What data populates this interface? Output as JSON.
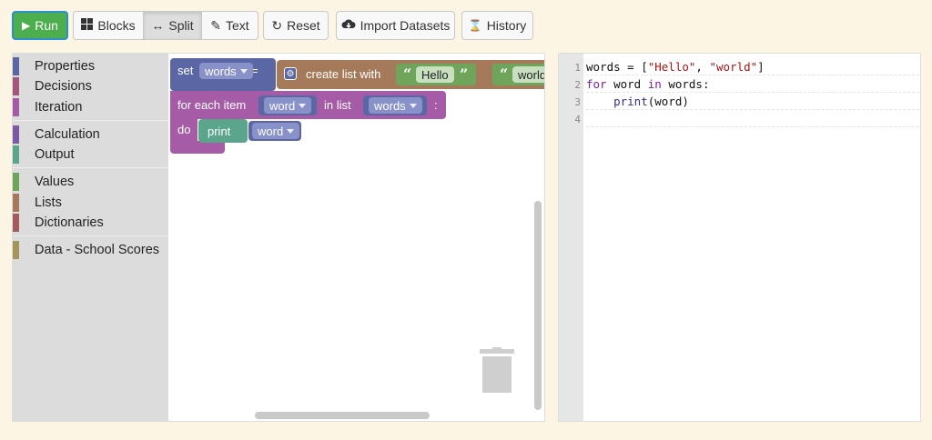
{
  "toolbar": {
    "run": "Run",
    "blocks": "Blocks",
    "split": "Split",
    "text": "Text",
    "reset": "Reset",
    "import": "Import Datasets",
    "history": "History"
  },
  "toolbox": {
    "categories": [
      {
        "label": "Properties",
        "color": "#5b67a5"
      },
      {
        "label": "Decisions",
        "color": "#a5577a"
      },
      {
        "label": "Iteration",
        "color": "#a55ba5"
      },
      {
        "label": "Calculation",
        "color": "#7b59a5"
      },
      {
        "label": "Output",
        "color": "#5ba58c"
      },
      {
        "label": "Values",
        "color": "#6fa55b"
      },
      {
        "label": "Lists",
        "color": "#a57a5b"
      },
      {
        "label": "Dictionaries",
        "color": "#a55b5b"
      },
      {
        "label": "Data - School Scores",
        "color": "#a5955b"
      }
    ]
  },
  "blocks": {
    "set_label": "set",
    "set_var": "words",
    "equals": "=",
    "create_list": "create list with",
    "item1": "Hello",
    "item2": "world",
    "for_each": "for each item",
    "for_var": "word",
    "in_list": "in list",
    "list_var": "words",
    "colon": ":",
    "do": "do",
    "print": "print",
    "print_var": "word"
  },
  "code": {
    "line_numbers": [
      "1",
      "2",
      "3",
      "4"
    ],
    "line1": {
      "a": "words = [",
      "s1": "\"Hello\"",
      "b": ", ",
      "s2": "\"world\"",
      "c": "]"
    },
    "line2": {
      "kw1": "for",
      "a": " word ",
      "kw2": "in",
      "b": " words:"
    },
    "line3": {
      "indent": "    ",
      "fn": "print",
      "b": "(word)"
    }
  },
  "colors": {
    "run": "#4cae4c",
    "variables": "#5b67a5",
    "lists": "#a57a5b",
    "text_values": "#6fa55b",
    "iteration": "#a55ba5",
    "output": "#5ba58c"
  }
}
